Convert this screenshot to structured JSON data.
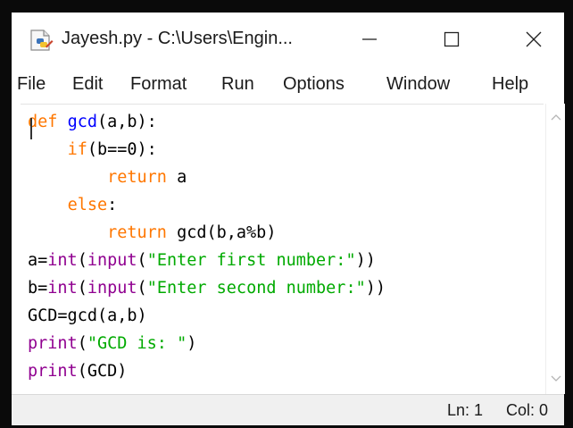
{
  "window": {
    "title": "Jayesh.py - C:\\Users\\Engin...",
    "icon": "python-file-icon",
    "controls": {
      "minimize": "minimize-icon",
      "maximize": "maximize-icon",
      "close": "close-icon"
    }
  },
  "menubar": {
    "items": [
      "File",
      "Edit",
      "Format",
      "Run",
      "Options",
      "Window",
      "Help"
    ]
  },
  "code": {
    "lines": [
      [
        {
          "t": "def",
          "c": "kw"
        },
        {
          "t": " "
        },
        {
          "t": "gcd",
          "c": "def"
        },
        {
          "t": "(a,b):"
        }
      ],
      [
        {
          "t": "    "
        },
        {
          "t": "if",
          "c": "kw"
        },
        {
          "t": "(b==0):"
        }
      ],
      [
        {
          "t": "        "
        },
        {
          "t": "return",
          "c": "kw"
        },
        {
          "t": " a"
        }
      ],
      [
        {
          "t": "    "
        },
        {
          "t": "else",
          "c": "kw"
        },
        {
          "t": ":"
        }
      ],
      [
        {
          "t": "        "
        },
        {
          "t": "return",
          "c": "kw"
        },
        {
          "t": " gcd(b,a%b)"
        }
      ],
      [
        {
          "t": "a="
        },
        {
          "t": "int",
          "c": "bi"
        },
        {
          "t": "("
        },
        {
          "t": "input",
          "c": "bi"
        },
        {
          "t": "("
        },
        {
          "t": "\"Enter first number:\"",
          "c": "str"
        },
        {
          "t": "))"
        }
      ],
      [
        {
          "t": "b="
        },
        {
          "t": "int",
          "c": "bi"
        },
        {
          "t": "("
        },
        {
          "t": "input",
          "c": "bi"
        },
        {
          "t": "("
        },
        {
          "t": "\"Enter second number:\"",
          "c": "str"
        },
        {
          "t": "))"
        }
      ],
      [
        {
          "t": "GCD=gcd(a,b)"
        }
      ],
      [
        {
          "t": "print",
          "c": "bi"
        },
        {
          "t": "("
        },
        {
          "t": "\"GCD is: \"",
          "c": "str"
        },
        {
          "t": ")"
        }
      ],
      [
        {
          "t": "print",
          "c": "bi"
        },
        {
          "t": "(GCD)"
        }
      ]
    ]
  },
  "syntax_colors": {
    "keyword": "#ff7700",
    "builtin": "#900090",
    "string": "#00aa00",
    "definition": "#0000ff",
    "default": "#000000"
  },
  "statusbar": {
    "line": "Ln: 1",
    "col": "Col: 0"
  }
}
